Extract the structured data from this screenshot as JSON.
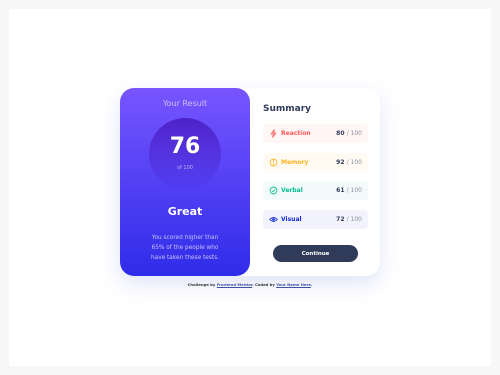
{
  "result": {
    "title": "Your Result",
    "score": "76",
    "out_of": "of 100",
    "grade": "Great",
    "description": "You scored higher than 65% of the people who have taken these tests."
  },
  "summary": {
    "title": "Summary",
    "items": [
      {
        "label": "Reaction",
        "score": "80",
        "total": "/ 100",
        "icon": "lightning-icon",
        "color": "#ff5757",
        "bg": "#fff6f5"
      },
      {
        "label": "Memory",
        "score": "92",
        "total": "/ 100",
        "icon": "brain-icon",
        "color": "#ffb01f",
        "bg": "#fffbf2"
      },
      {
        "label": "Verbal",
        "score": "61",
        "total": "/ 100",
        "icon": "chat-icon",
        "color": "#00bb8f",
        "bg": "#f2fbfa"
      },
      {
        "label": "Visual",
        "score": "72",
        "total": "/ 100",
        "icon": "eye-icon",
        "color": "#1125d6",
        "bg": "#f3f3fd"
      }
    ]
  },
  "button": {
    "continue_label": "Continue"
  },
  "attribution": {
    "prefix": "Challenge by",
    "challenge_link": "Frontend Mentor",
    "middle": ". Coded by",
    "author_link": "Your Name Here",
    "suffix": "."
  }
}
